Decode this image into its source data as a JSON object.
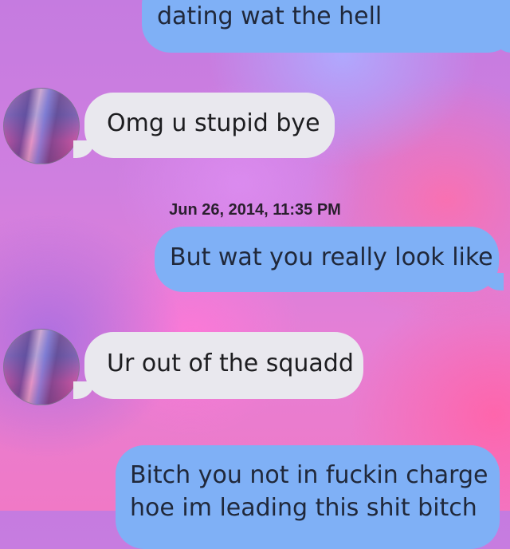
{
  "messages": [
    {
      "side": "sent",
      "text": "dating wat the hell"
    },
    {
      "side": "received",
      "text": "Omg u stupid bye"
    },
    {
      "side": "sent",
      "text": "But wat you really look like"
    },
    {
      "side": "received",
      "text": "Ur out of the squadd"
    },
    {
      "side": "sent",
      "lines": [
        "Bitch you not in fuckin charge",
        "hoe im leading this shit bitch"
      ]
    }
  ],
  "timestamp": "Jun 26, 2014, 11:35 PM",
  "colors": {
    "sent_bubble": "#7fb0f6",
    "received_bubble": "#e9e8ee",
    "timestamp_text": "#2a1f2e"
  },
  "icons": {
    "avatar": "contact-photo"
  }
}
